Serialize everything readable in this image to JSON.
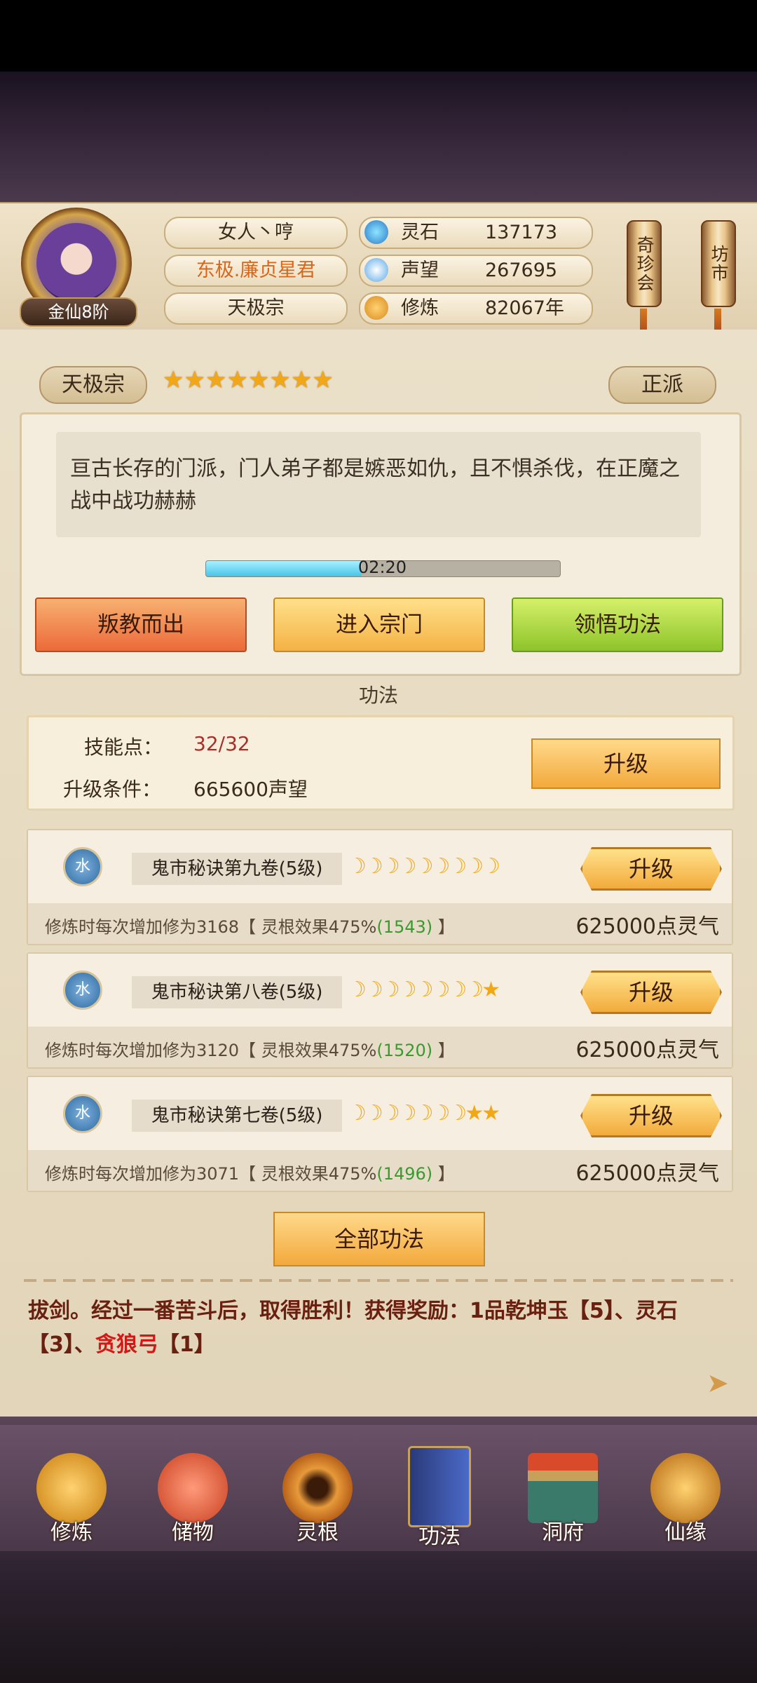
{
  "header": {
    "rank": "金仙8阶",
    "name": "女人丶哼",
    "title": "东极.廉贞星君",
    "sect": "天极宗",
    "resources": [
      {
        "label": "灵石",
        "value": "137173",
        "icon": "spirit-stone-icon"
      },
      {
        "label": "声望",
        "value": "267695",
        "icon": "reputation-icon"
      },
      {
        "label": "修炼",
        "value": "82067年",
        "icon": "meditation-icon"
      }
    ],
    "side_buttons": [
      "奇珍会",
      "坊市"
    ]
  },
  "sect_panel": {
    "name": "天极宗",
    "stars": 8,
    "alignment": "正派",
    "description": "亘古长存的门派，门人弟子都是嫉恶如仇，且不惧杀伐，在正魔之战中战功赫赫",
    "timer": "02:20",
    "timer_progress": 0.44,
    "buttons": [
      "叛教而出",
      "进入宗门",
      "领悟功法"
    ]
  },
  "skills": {
    "section_title": "功法",
    "points_label": "技能点：",
    "points_value": "32/32",
    "condition_label": "升级条件：",
    "condition_value": "665600声望",
    "upgrade_label": "升级",
    "techniques": [
      {
        "element": "水",
        "name": "鬼市秘诀第九卷(5级)",
        "moons": "☽☽☽☽☽☽☽☽☽",
        "desc_prefix": "修炼时每次增加修为3168【 灵根效果475%",
        "desc_bonus": "(1543)",
        "desc_suffix": " 】",
        "cost": "625000点灵气",
        "upgrade": "升级"
      },
      {
        "element": "水",
        "name": "鬼市秘诀第八卷(5级)",
        "moons": "☽☽☽☽☽☽☽☽★",
        "desc_prefix": "修炼时每次增加修为3120【 灵根效果475%",
        "desc_bonus": "(1520)",
        "desc_suffix": " 】",
        "cost": "625000点灵气",
        "upgrade": "升级"
      },
      {
        "element": "水",
        "name": "鬼市秘诀第七卷(5级)",
        "moons": "☽☽☽☽☽☽☽★★",
        "desc_prefix": "修炼时每次增加修为3071【 灵根效果475%",
        "desc_bonus": "(1496)",
        "desc_suffix": " 】",
        "cost": "625000点灵气",
        "upgrade": "升级"
      }
    ],
    "all_button": "全部功法"
  },
  "message": {
    "part1": "拔剑。经过一番苦斗后，取得胜利！获得奖励：1品乾坤玉【5】、灵石【3】、",
    "highlight": "贪狼弓",
    "part2": "【1】"
  },
  "nav": [
    {
      "label": "修炼",
      "icon": "cultivate-icon",
      "color": "#d8962a"
    },
    {
      "label": "储物",
      "icon": "storage-bag-icon",
      "color": "#d85a3a"
    },
    {
      "label": "灵根",
      "icon": "spirit-root-icon",
      "color": "#b8621a"
    },
    {
      "label": "功法",
      "icon": "scripture-book-icon",
      "color": "#3a5aa8"
    },
    {
      "label": "洞府",
      "icon": "cave-house-icon",
      "color": "#9a6a3a"
    },
    {
      "label": "仙缘",
      "icon": "gourd-icon",
      "color": "#c8842a"
    }
  ],
  "colors": {
    "title_orange": "#d8661a",
    "value_red": "#a8302a",
    "bonus_green": "#3a9a30",
    "reward_red": "#d41818"
  }
}
